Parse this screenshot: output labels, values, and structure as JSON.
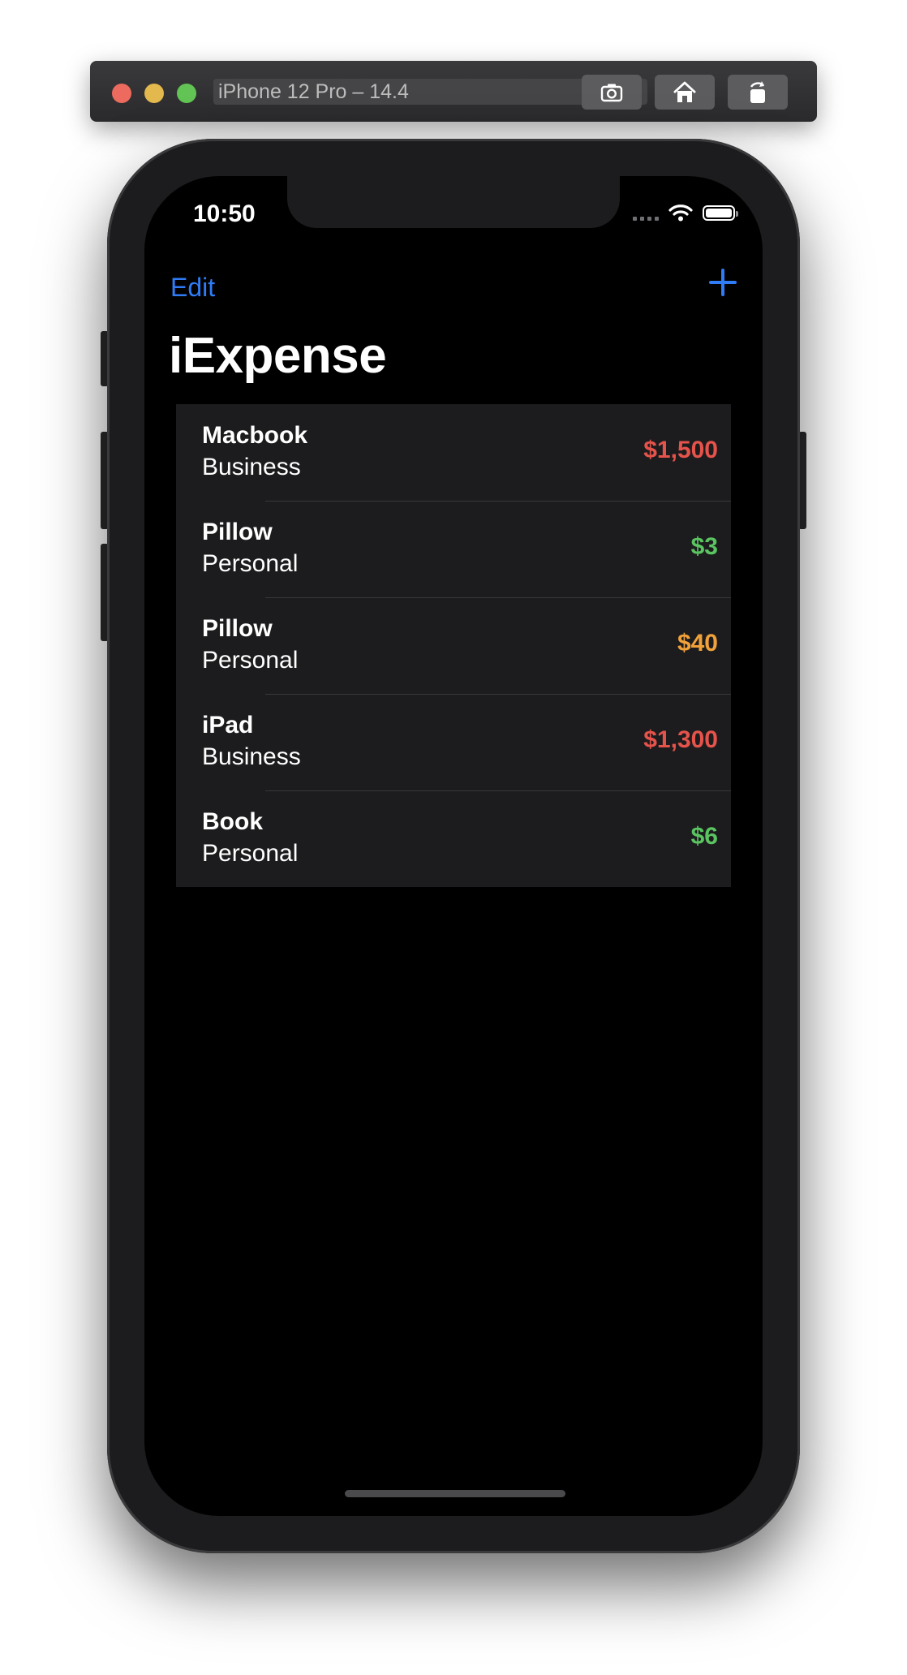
{
  "simulator": {
    "title": "iPhone 12 Pro – 14.4",
    "buttons": [
      {
        "icon": "screenshot-icon"
      },
      {
        "icon": "home-icon"
      },
      {
        "icon": "rotate-icon"
      }
    ]
  },
  "status_bar": {
    "time": "10:50"
  },
  "nav": {
    "edit_label": "Edit",
    "add_icon": "plus-icon",
    "title": "iExpense"
  },
  "expenses": [
    {
      "name": "Macbook",
      "type": "Business",
      "amount": "$1,500",
      "color": "#e5534b"
    },
    {
      "name": "Pillow",
      "type": "Personal",
      "amount": "$3",
      "color": "#5ac560"
    },
    {
      "name": "Pillow",
      "type": "Personal",
      "amount": "$40",
      "color": "#f0a13a"
    },
    {
      "name": "iPad",
      "type": "Business",
      "amount": "$1,300",
      "color": "#e5534b"
    },
    {
      "name": "Book",
      "type": "Personal",
      "amount": "$6",
      "color": "#5ac560"
    }
  ],
  "colors": {
    "accent": "#2f7cf6",
    "background": "#000000",
    "list_background": "#1c1c1e"
  }
}
